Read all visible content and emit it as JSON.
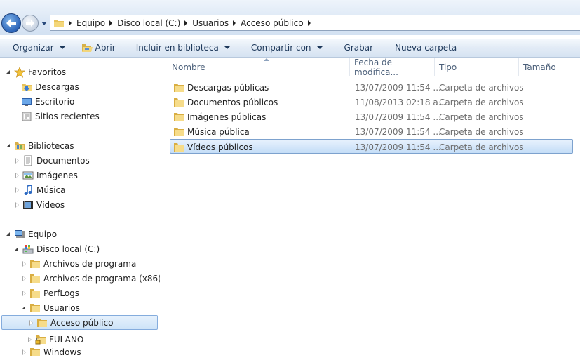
{
  "address": {
    "crumbs": [
      "Equipo",
      "Disco local (C:)",
      "Usuarios",
      "Acceso público"
    ]
  },
  "toolbar": {
    "organizar": "Organizar",
    "abrir": "Abrir",
    "incluir": "Incluir en biblioteca",
    "compartir": "Compartir con",
    "grabar": "Grabar",
    "nueva_carpeta": "Nueva carpeta"
  },
  "nav": {
    "favoritos": "Favoritos",
    "descargas": "Descargas",
    "escritorio": "Escritorio",
    "sitios": "Sitios recientes",
    "bibliotecas": "Bibliotecas",
    "documentos": "Documentos",
    "imagenes": "Imágenes",
    "musica": "Música",
    "videos": "Vídeos",
    "equipo": "Equipo",
    "disco": "Disco local (C:)",
    "archivos_programa": "Archivos de programa",
    "archivos_programa_x86": "Archivos de programa (x86)",
    "perflogs": "PerfLogs",
    "usuarios": "Usuarios",
    "acceso_publico": "Acceso público",
    "fulano": "FULANO",
    "windows": "Windows"
  },
  "columns": {
    "nombre": "Nombre",
    "fecha": "Fecha de modifica...",
    "tipo": "Tipo",
    "tamano": "Tamaño"
  },
  "files": [
    {
      "name": "Descargas públicas",
      "date": "13/07/2009 11:54 ...",
      "type": "Carpeta de archivos"
    },
    {
      "name": "Documentos públicos",
      "date": "11/08/2013 02:18 a...",
      "type": "Carpeta de archivos"
    },
    {
      "name": "Imágenes públicas",
      "date": "13/07/2009 11:54 ...",
      "type": "Carpeta de archivos"
    },
    {
      "name": "Música pública",
      "date": "13/07/2009 11:54 ...",
      "type": "Carpeta de archivos"
    },
    {
      "name": "Vídeos públicos",
      "date": "13/07/2009 11:54 ...",
      "type": "Carpeta de archivos"
    }
  ]
}
